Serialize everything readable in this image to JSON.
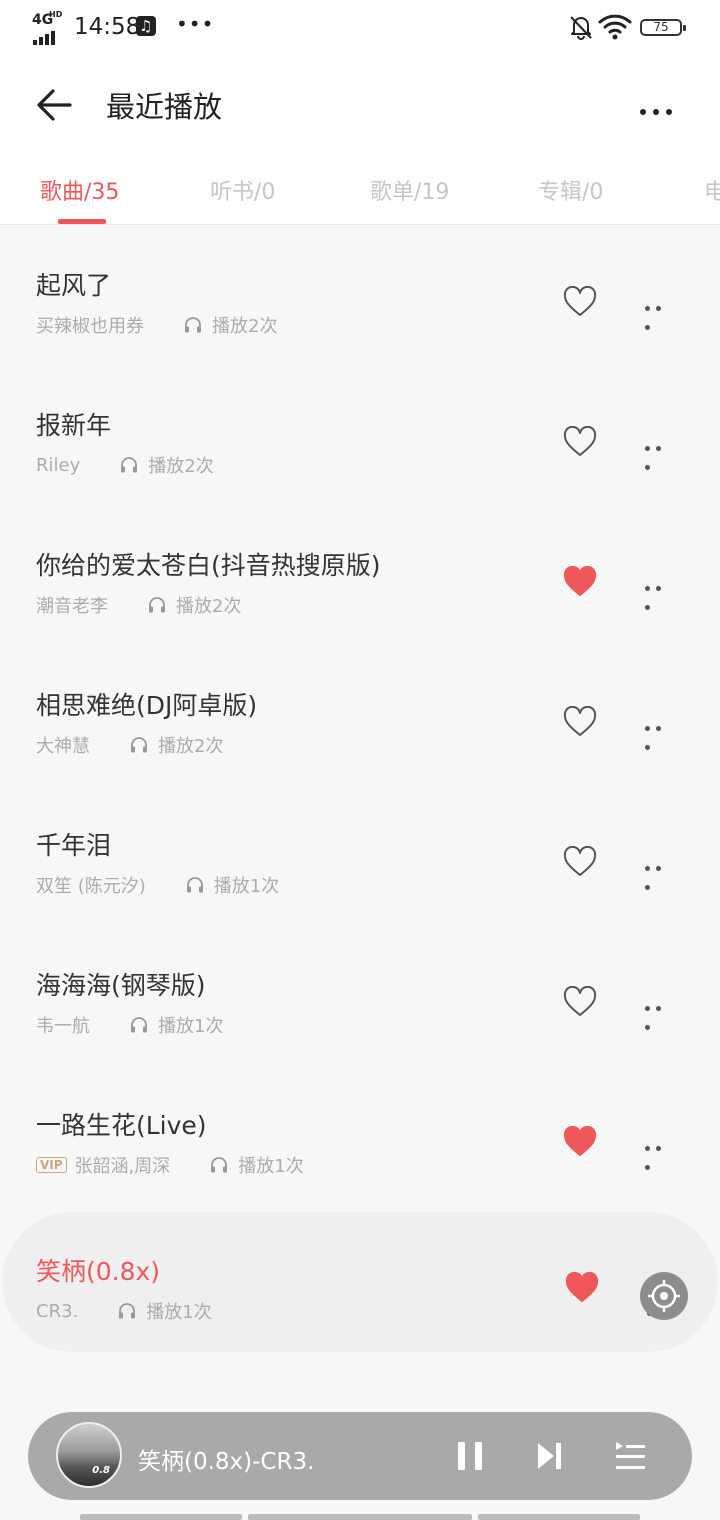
{
  "status_bar": {
    "network": "4G",
    "network_sup": "HD",
    "time": "14:58",
    "overflow": "•••",
    "battery": "75"
  },
  "header": {
    "title": "最近播放"
  },
  "tabs": [
    {
      "label": "歌曲/35"
    },
    {
      "label": "听书/0"
    },
    {
      "label": "歌单/19"
    },
    {
      "label": "专辑/0"
    },
    {
      "label": "电"
    }
  ],
  "songs": [
    {
      "title": "起风了",
      "artist": "买辣椒也用券",
      "plays": "播放2次",
      "liked": false,
      "vip": false
    },
    {
      "title": "报新年",
      "artist": "Riley",
      "plays": "播放2次",
      "liked": false,
      "vip": false
    },
    {
      "title": "你给的爱太苍白(抖音热搜原版)",
      "artist": "潮音老李",
      "plays": "播放2次",
      "liked": true,
      "vip": false
    },
    {
      "title": "相思难绝(DJ阿卓版)",
      "artist": "大神慧",
      "plays": "播放2次",
      "liked": false,
      "vip": false
    },
    {
      "title": "千年泪",
      "artist": "双笙 (陈元汐)",
      "plays": "播放1次",
      "liked": false,
      "vip": false
    },
    {
      "title": "海海海(钢琴版)",
      "artist": "韦一航",
      "plays": "播放1次",
      "liked": false,
      "vip": false
    },
    {
      "title": "一路生花(Live)",
      "artist": "张韶涵,周深",
      "plays": "播放1次",
      "liked": true,
      "vip": true,
      "vip_label": "VIP"
    },
    {
      "title": "笑柄(0.8x)",
      "artist": "CR3.",
      "plays": "播放1次",
      "liked": true,
      "vip": false,
      "current": true
    }
  ],
  "player": {
    "now_playing": "笑柄(0.8x)-CR3.",
    "cover_badge": "0.8"
  },
  "colors": {
    "accent": "#f0575a",
    "liked_heart": "#f0575a",
    "background": "#f7f7f7",
    "player_bg": "#a9a9a9"
  },
  "icons": {
    "back": "arrow-left-icon",
    "more": "more-horizontal-icon",
    "heart": "heart-icon",
    "plays": "headphones-icon",
    "locate": "locate-crosshair-icon",
    "pause": "pause-icon",
    "next": "skip-next-icon",
    "queue": "playlist-queue-icon"
  }
}
